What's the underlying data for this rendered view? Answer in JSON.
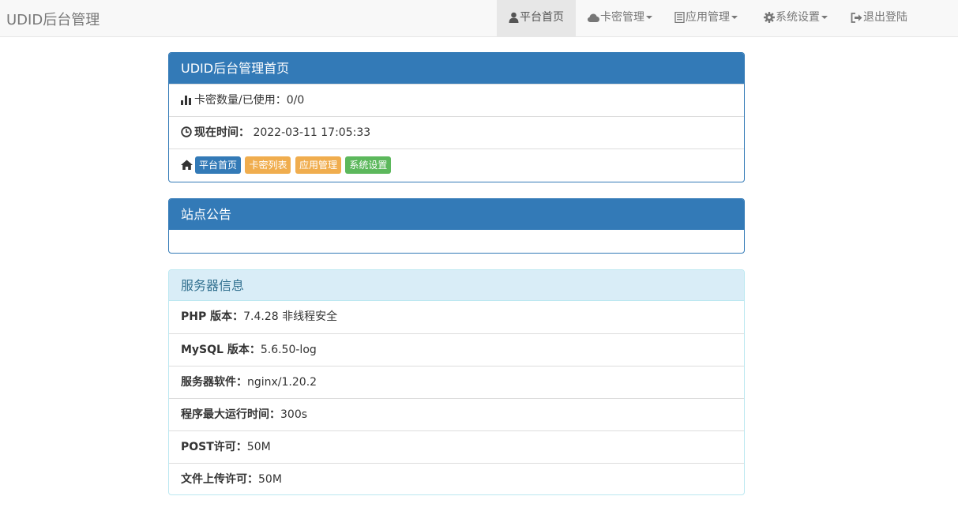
{
  "navbar": {
    "brand": "UDID后台管理",
    "items": [
      {
        "label": "平台首页",
        "icon": "user-icon"
      },
      {
        "label": "卡密管理",
        "icon": "cloud-icon",
        "dropdown": true
      },
      {
        "label": "应用管理",
        "icon": "list-icon",
        "dropdown": true
      },
      {
        "label": "系统设置",
        "icon": "gear-icon",
        "dropdown": true
      },
      {
        "label": "退出登陆",
        "icon": "logout-icon"
      }
    ]
  },
  "home_panel": {
    "title": "UDID后台管理首页",
    "card_stats": {
      "label": "卡密数量/已使用：",
      "value": "0/0",
      "icon": "bar-chart-icon"
    },
    "current_time": {
      "label": "现在时间：",
      "value": "2022-03-11 17:05:33",
      "icon": "clock-icon"
    },
    "quick_links": [
      {
        "label": "平台首页",
        "color": "#337ab7"
      },
      {
        "label": "卡密列表",
        "color": "#f0ad4e"
      },
      {
        "label": "应用管理",
        "color": "#f0ad4e"
      },
      {
        "label": "系统设置",
        "color": "#5cb85c"
      }
    ]
  },
  "notice_panel": {
    "title": "站点公告",
    "content": ""
  },
  "server_panel": {
    "title": "服务器信息",
    "rows": [
      {
        "label": "PHP 版本：",
        "value": "7.4.28 非线程安全"
      },
      {
        "label": "MySQL 版本：",
        "value": "5.6.50-log"
      },
      {
        "label": "服务器软件：",
        "value": "nginx/1.20.2"
      },
      {
        "label": "程序最大运行时间：",
        "value": "300s"
      },
      {
        "label": "POST许可：",
        "value": "50M"
      },
      {
        "label": "文件上传许可：",
        "value": "50M"
      }
    ]
  }
}
